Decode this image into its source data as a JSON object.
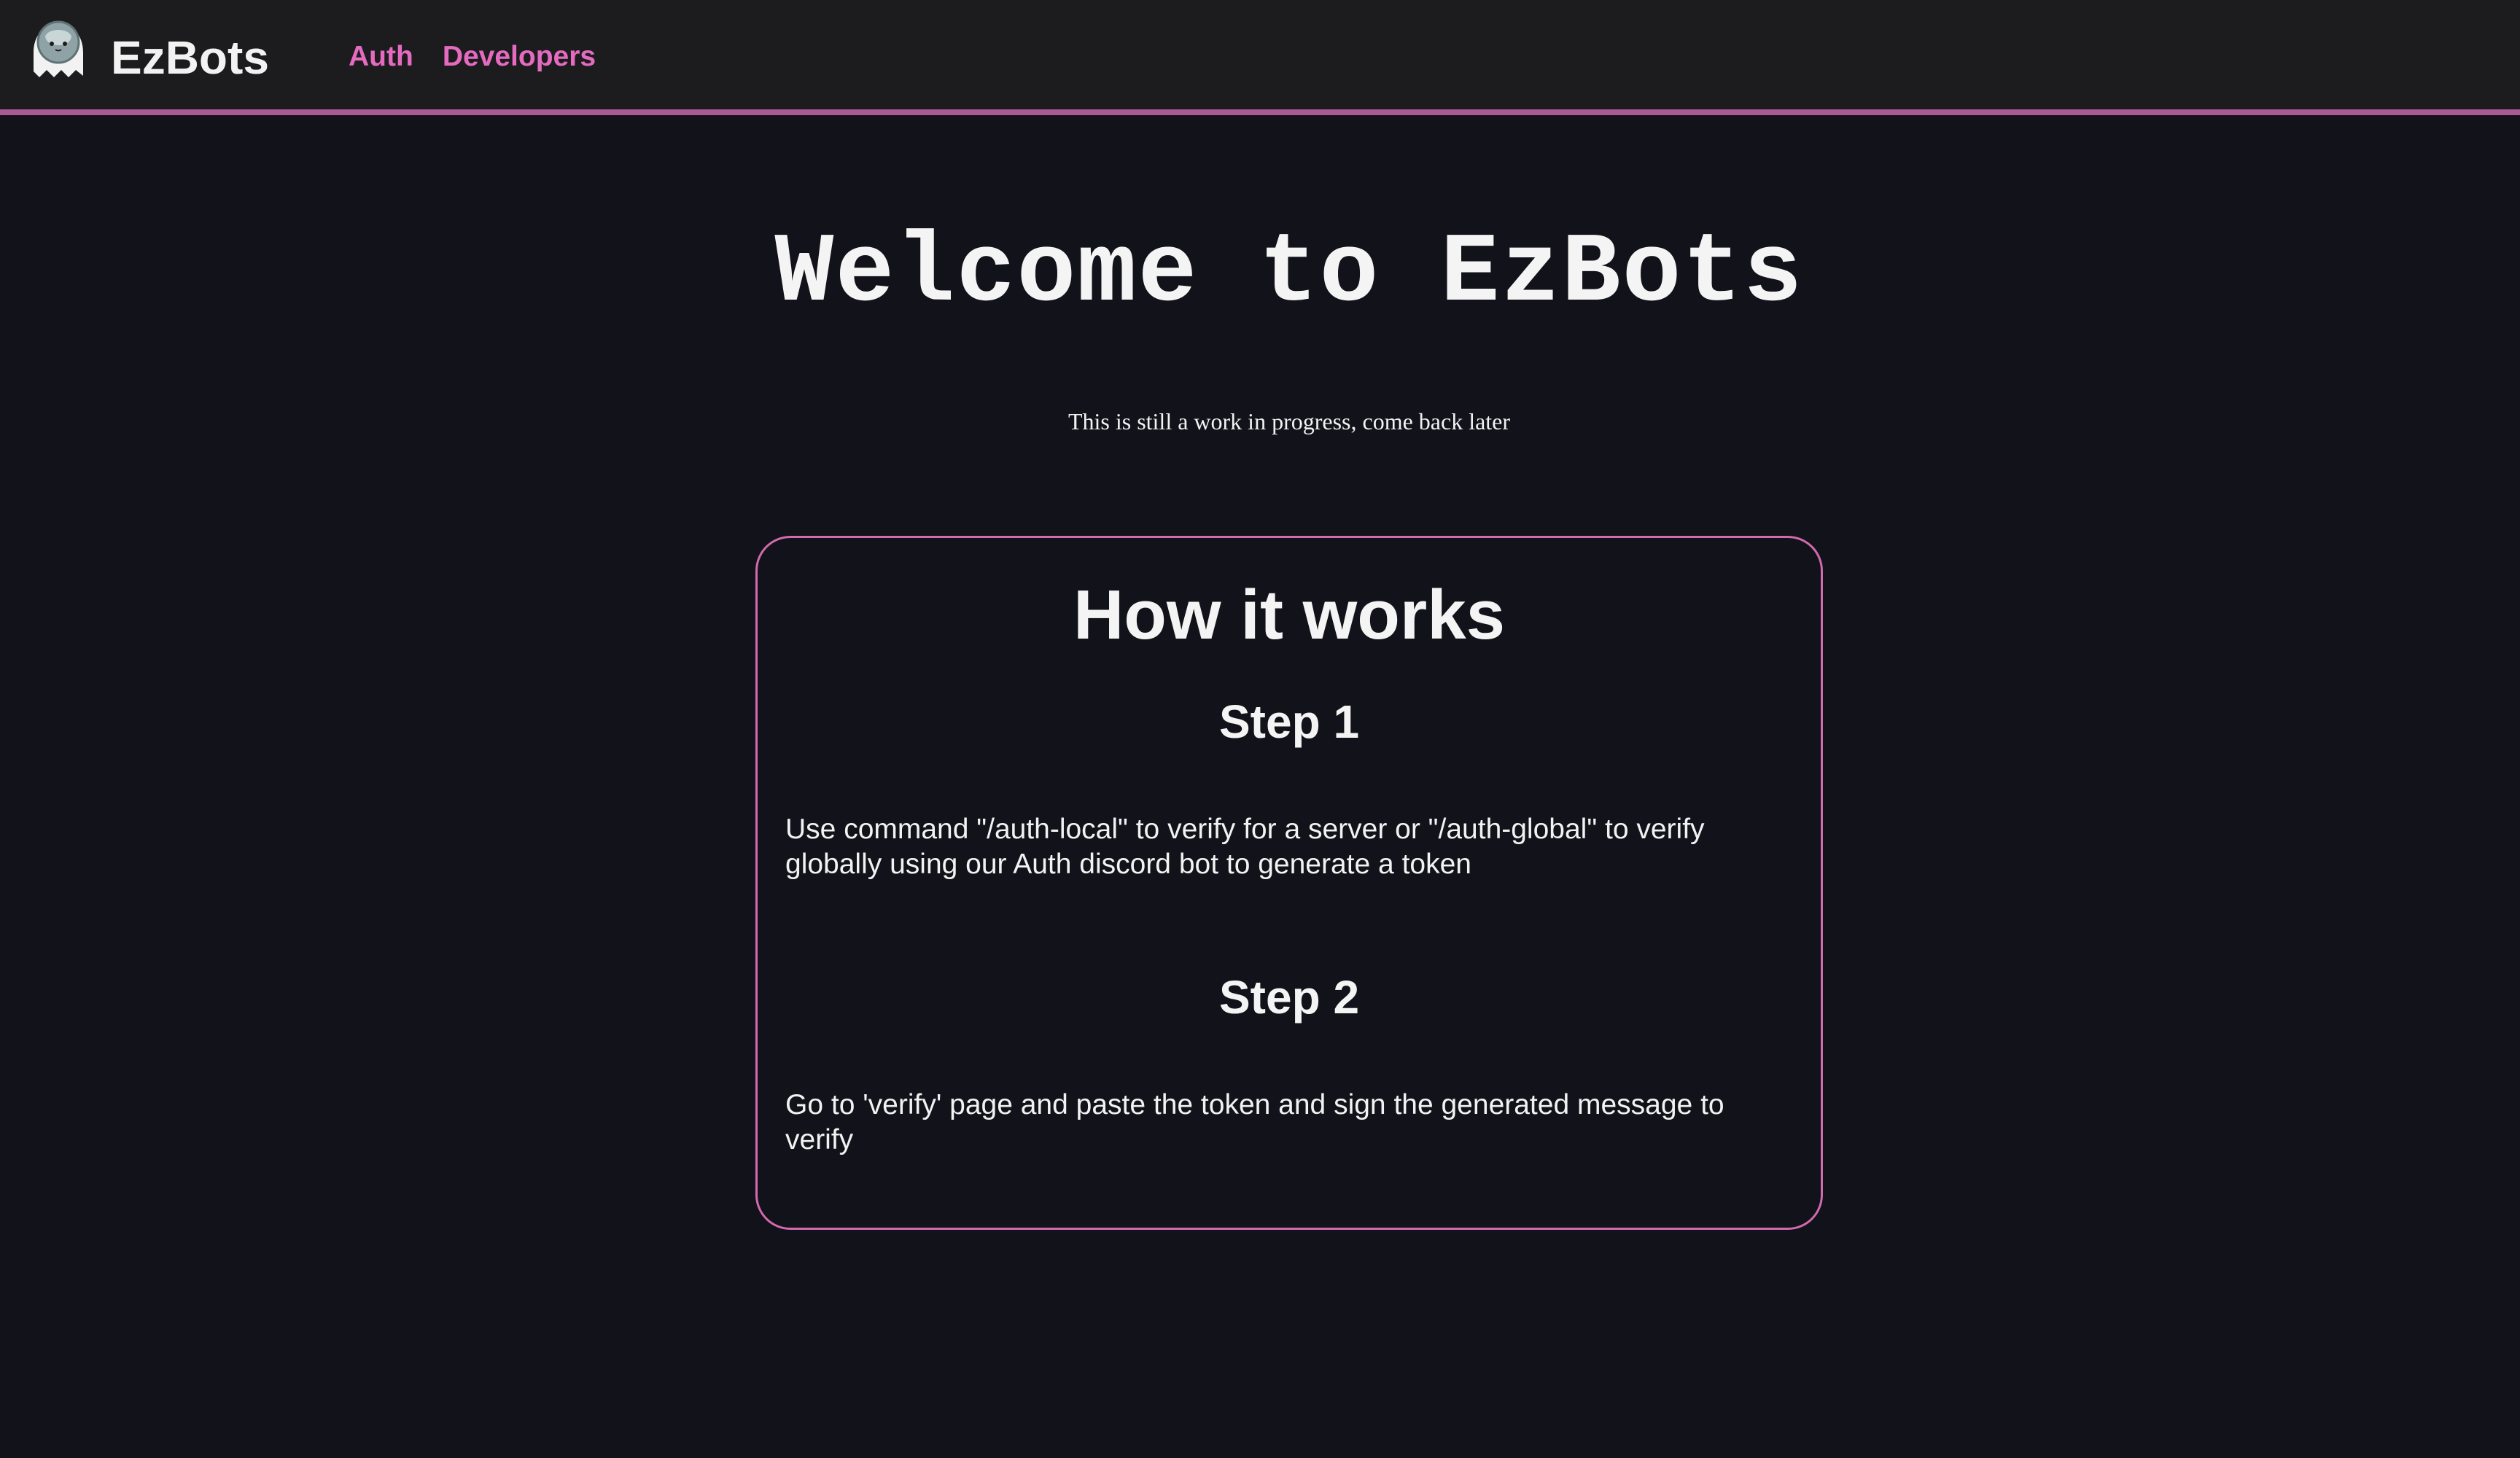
{
  "navbar": {
    "brand": "EzBots",
    "logo_icon": "ghost-icon",
    "links": [
      {
        "label": "Auth"
      },
      {
        "label": "Developers"
      }
    ],
    "accent_color": "#e46bc0"
  },
  "hero": {
    "title": "Welcome to EzBots",
    "subtitle": "This is still a work in progress, come back later"
  },
  "how_it_works": {
    "title": "How it works",
    "steps": [
      {
        "title": "Step 1",
        "text": "Use command \"/auth-local\" to verify for a server or \"/auth-global\" to verify globally using our Auth discord bot to generate a token"
      },
      {
        "title": "Step 2",
        "text": "Go to 'verify' page and paste the token and sign the generated message to verify"
      }
    ],
    "border_color": "#d26aae"
  }
}
